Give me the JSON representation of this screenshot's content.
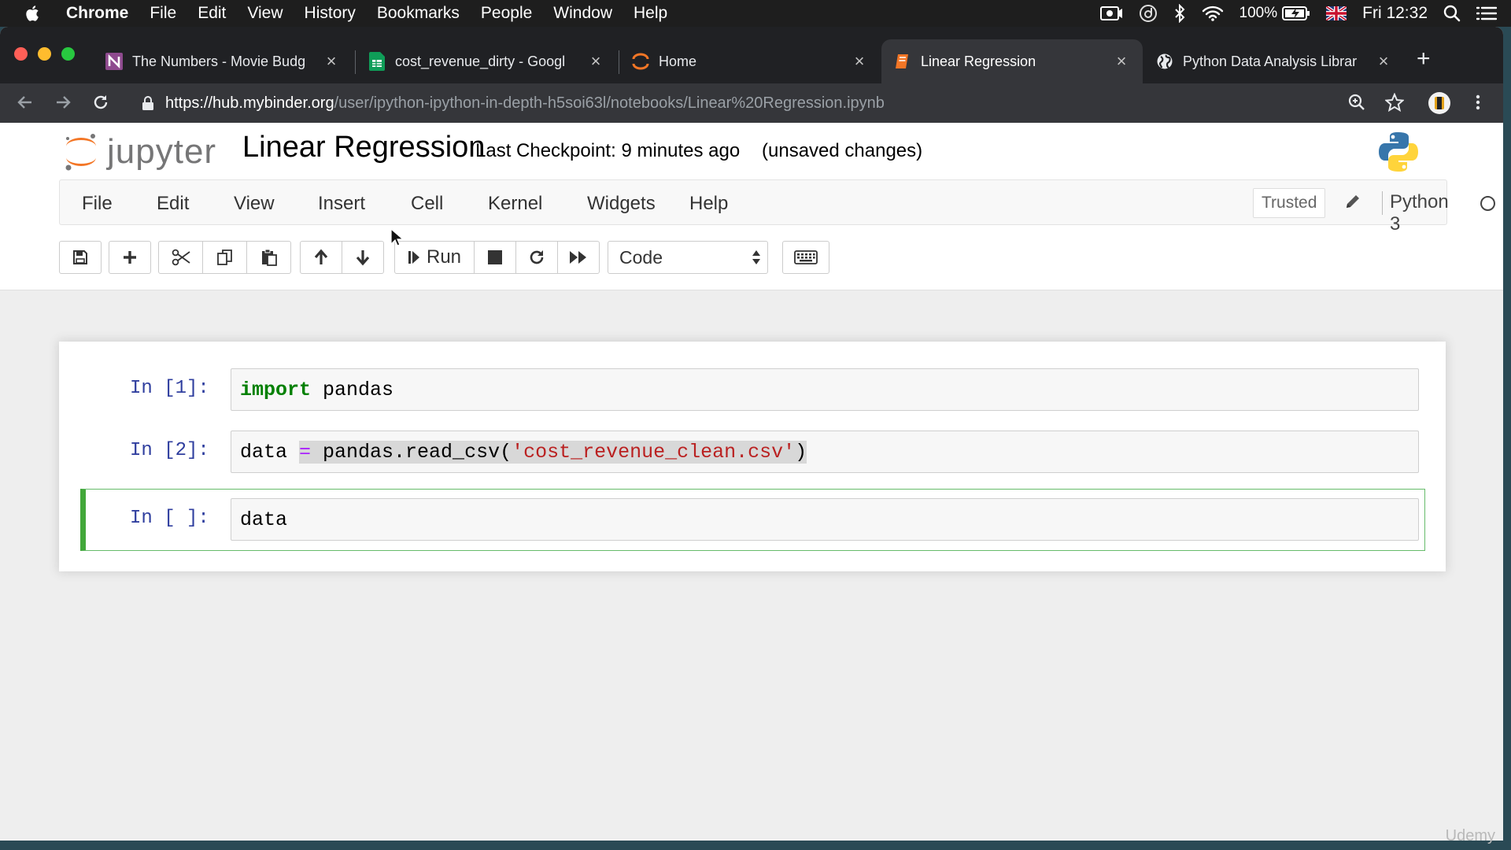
{
  "menubar": {
    "app": "Chrome",
    "items": [
      "File",
      "Edit",
      "View",
      "History",
      "Bookmarks",
      "People",
      "Window",
      "Help"
    ],
    "battery": "100%",
    "clock": "Fri 12:32"
  },
  "tabs": [
    {
      "title": "The Numbers - Movie Budg",
      "icon": "numbers-favicon"
    },
    {
      "title": "cost_revenue_dirty - Googl",
      "icon": "sheets-favicon"
    },
    {
      "title": "Home",
      "icon": "jupyter-favicon"
    },
    {
      "title": "Linear Regression",
      "icon": "notebook-favicon",
      "active": true
    },
    {
      "title": "Python Data Analysis Librar",
      "icon": "globe-favicon"
    }
  ],
  "address": {
    "host": "https://hub.mybinder.org",
    "path": "/user/ipython-ipython-in-depth-h5soi63l/notebooks/Linear%20Regression.ipynb"
  },
  "jupyter": {
    "logo_word": "jupyter",
    "title": "Linear Regression",
    "checkpoint": "Last Checkpoint: 9 minutes ago",
    "unsaved": "(unsaved changes)",
    "menu": [
      "File",
      "Edit",
      "View",
      "Insert",
      "Cell",
      "Kernel",
      "Widgets",
      "Help"
    ],
    "trusted": "Trusted",
    "kernel": "Python 3",
    "run_label": "Run",
    "cell_type": "Code"
  },
  "cells": [
    {
      "prompt": "In [1]:",
      "tokens": [
        {
          "t": "import",
          "c": "kw"
        },
        {
          "t": " pandas",
          "c": ""
        }
      ]
    },
    {
      "prompt": "In [2]:",
      "tokens": [
        {
          "t": "data ",
          "c": ""
        },
        {
          "t": "=",
          "c": "op"
        },
        {
          "t": " pandas.read_csv(",
          "c": "hl"
        },
        {
          "t": "'cost_revenue_clean.csv'",
          "c": "str hl"
        },
        {
          "t": ")",
          "c": "hl"
        }
      ]
    },
    {
      "prompt": "In [ ]:",
      "tokens": [
        {
          "t": "data",
          "c": ""
        }
      ]
    }
  ],
  "watermark": "Udemy",
  "colors": {
    "jupyter_orange": "#f37626",
    "selected_cell": "#42a73a",
    "prompt_blue": "#303f9f",
    "string_red": "#ba2121",
    "keyword_green": "#008000",
    "operator_purple": "#aa22ff"
  }
}
